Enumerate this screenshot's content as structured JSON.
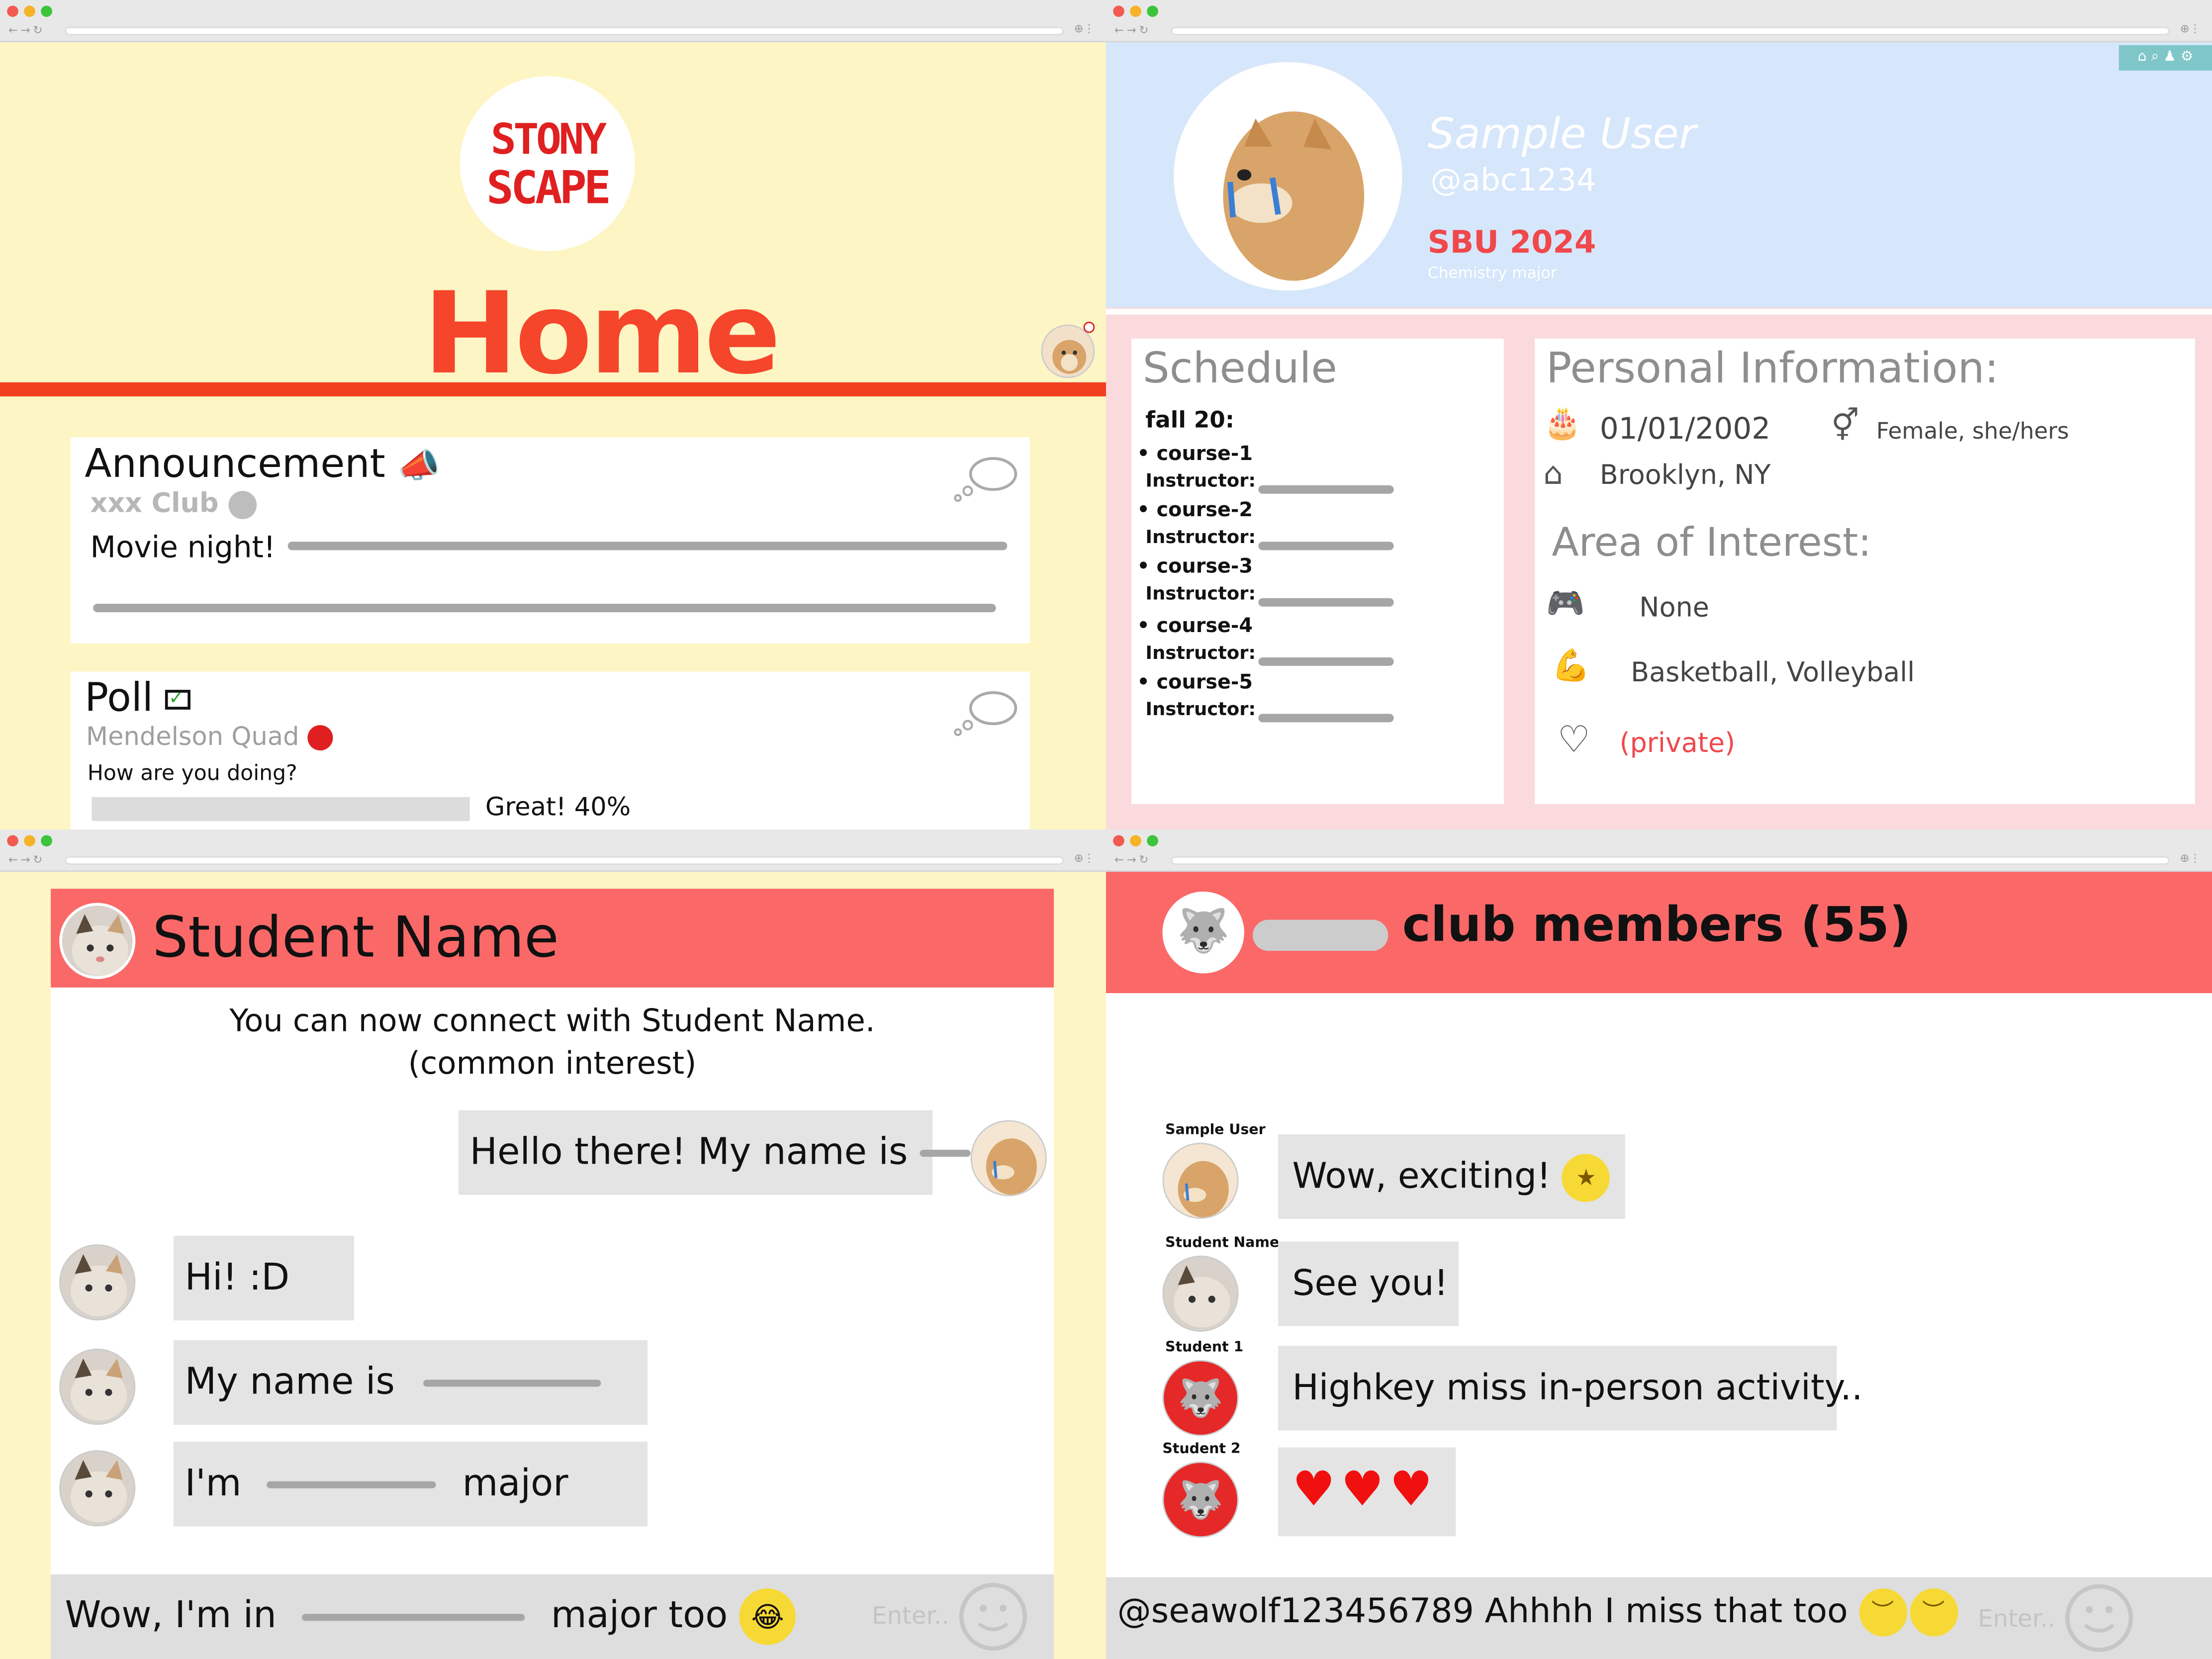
{
  "home": {
    "logo_line1": "STONY",
    "logo_line2": "SCAPE",
    "title": "Home",
    "announcement": {
      "title": "Announcement",
      "club": "xxx Club",
      "text": "Movie night!"
    },
    "poll": {
      "title": "Poll",
      "location": "Mendelson Quad",
      "question": "How are you doing?",
      "answer": "Great!",
      "percent": "40%",
      "percent_value": 40
    }
  },
  "profile": {
    "name": "Sample User",
    "handle": "@abc1234",
    "class": "SBU 2024",
    "major": "Chemistry major",
    "schedule": {
      "title": "Schedule",
      "term": "fall 20:",
      "instructor_label": "Instructor:",
      "courses": [
        "course-1",
        "course-2",
        "course-3",
        "course-4",
        "course-5"
      ]
    },
    "personal": {
      "title": "Personal Information:",
      "birthday": "01/01/2002",
      "gender": "Female, she/hers",
      "location": "Brooklyn, NY",
      "interest_title": "Area of Interest:",
      "gaming": "None",
      "sports": "Basketball, Volleyball",
      "relationship": "(private)"
    }
  },
  "chat": {
    "name": "Student Name",
    "connect_line1": "You can now connect with Student Name.",
    "connect_line2": "(common interest)",
    "messages": [
      {
        "from": "me",
        "text": "Hello there! My name is"
      },
      {
        "from": "them",
        "text": "Hi! :D"
      },
      {
        "from": "them",
        "text": "My name is"
      },
      {
        "from": "them",
        "text_pre": "I'm",
        "text_post": "major"
      }
    ],
    "input_pre": "Wow, I'm in",
    "input_post": "major too",
    "enter_placeholder": "Enter.."
  },
  "club": {
    "title": "club members (55)",
    "messages": [
      {
        "name": "Sample User",
        "text": "Wow, exciting!"
      },
      {
        "name": "Student Name",
        "text": "See you!"
      },
      {
        "name": "Student 1",
        "text": "Highkey miss in-person activity.."
      },
      {
        "name": "Student 2",
        "text": ""
      }
    ],
    "input": "@seawolf123456789 Ahhhh I miss that too",
    "enter_placeholder": "Enter.."
  }
}
